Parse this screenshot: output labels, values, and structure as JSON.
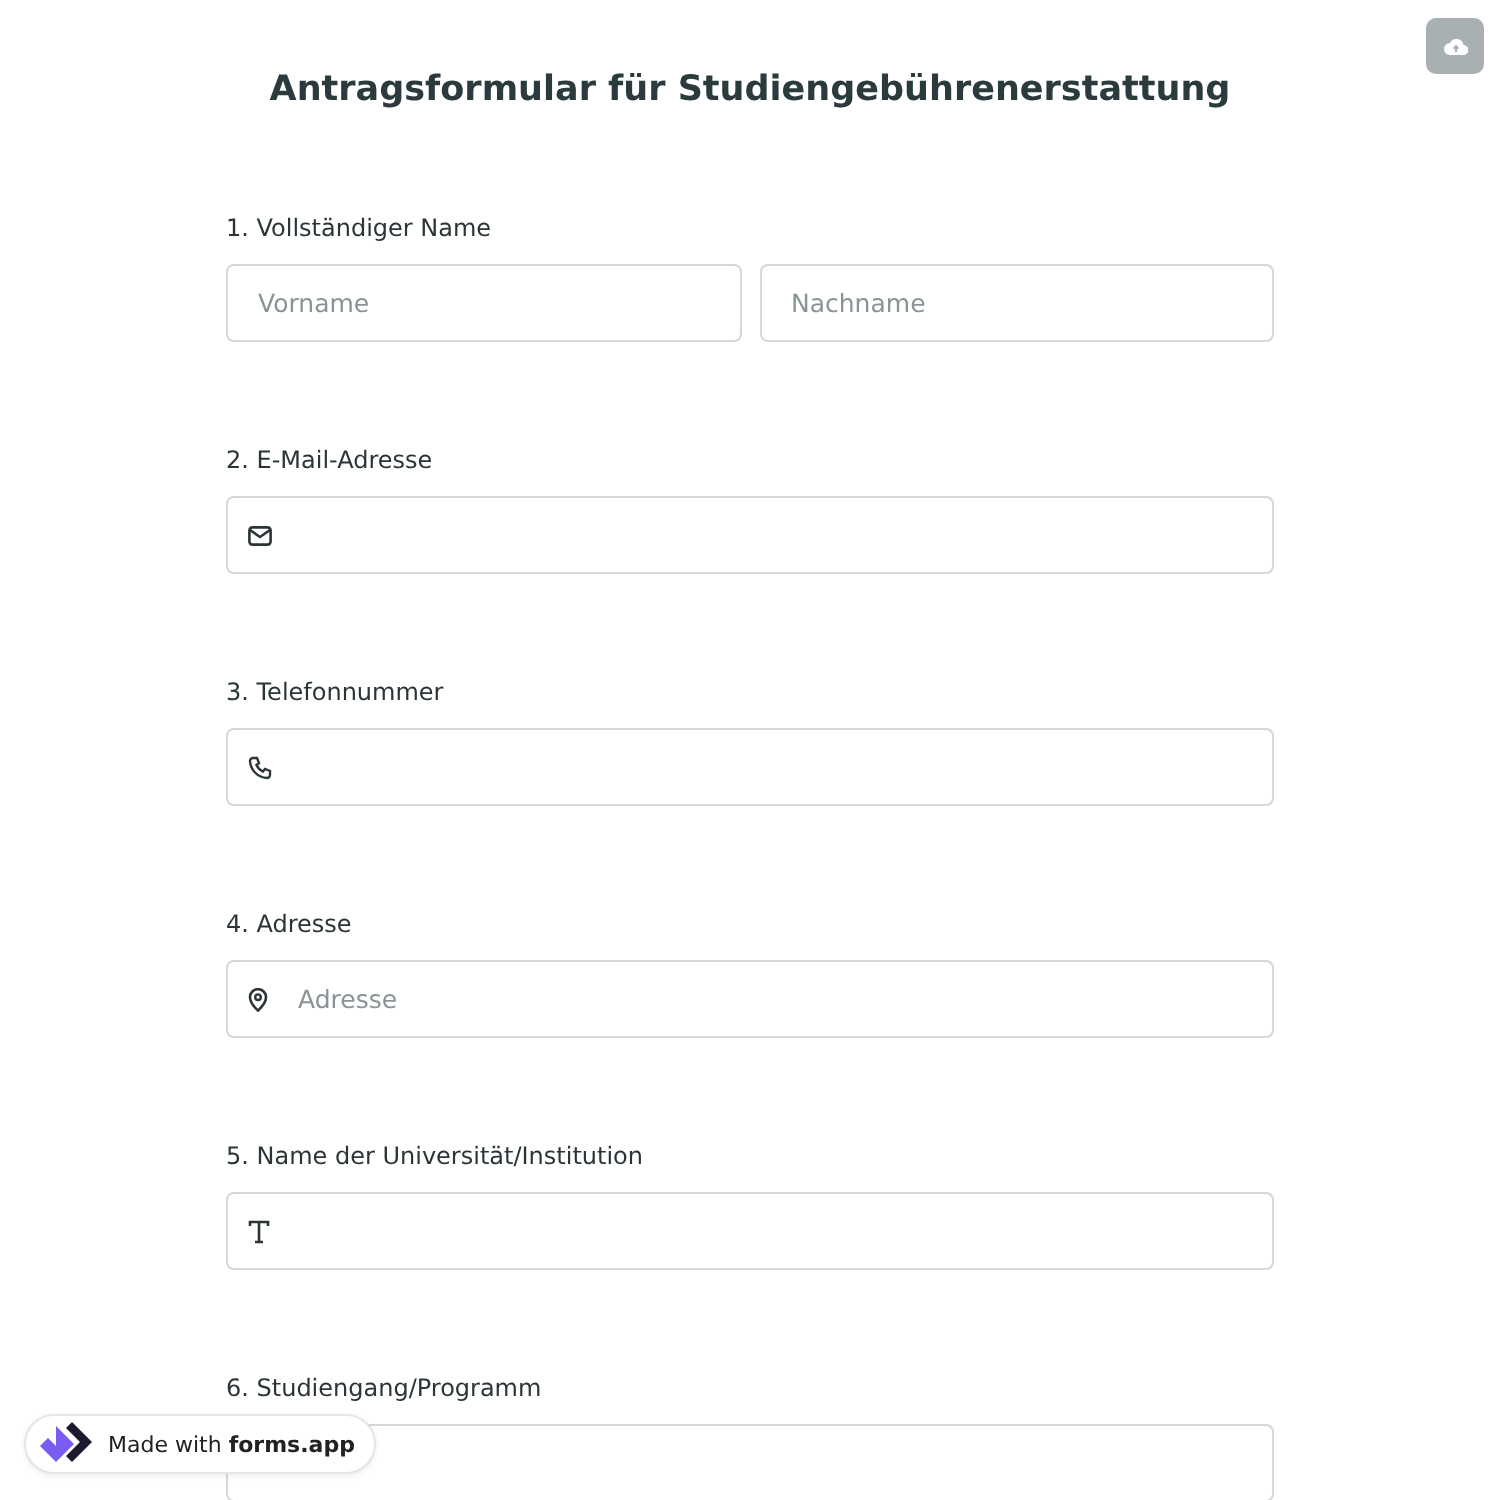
{
  "title": "Antragsformular für Studiengebührenerstattung",
  "questions": [
    {
      "number": "1.",
      "label": "Vollständiger Name",
      "kind": "name",
      "placeholders": [
        "Vorname",
        "Nachname"
      ]
    },
    {
      "number": "2.",
      "label": "E-Mail-Adresse",
      "kind": "email"
    },
    {
      "number": "3.",
      "label": "Telefonnummer",
      "kind": "phone"
    },
    {
      "number": "4.",
      "label": "Adresse",
      "kind": "address",
      "placeholder": "Adresse"
    },
    {
      "number": "5.",
      "label": "Name der Universität/Institution",
      "kind": "text"
    },
    {
      "number": "6.",
      "label": "Studiengang/Programm",
      "kind": "plain"
    }
  ],
  "badge": {
    "prefix": "Made with",
    "brand": "forms.app"
  }
}
